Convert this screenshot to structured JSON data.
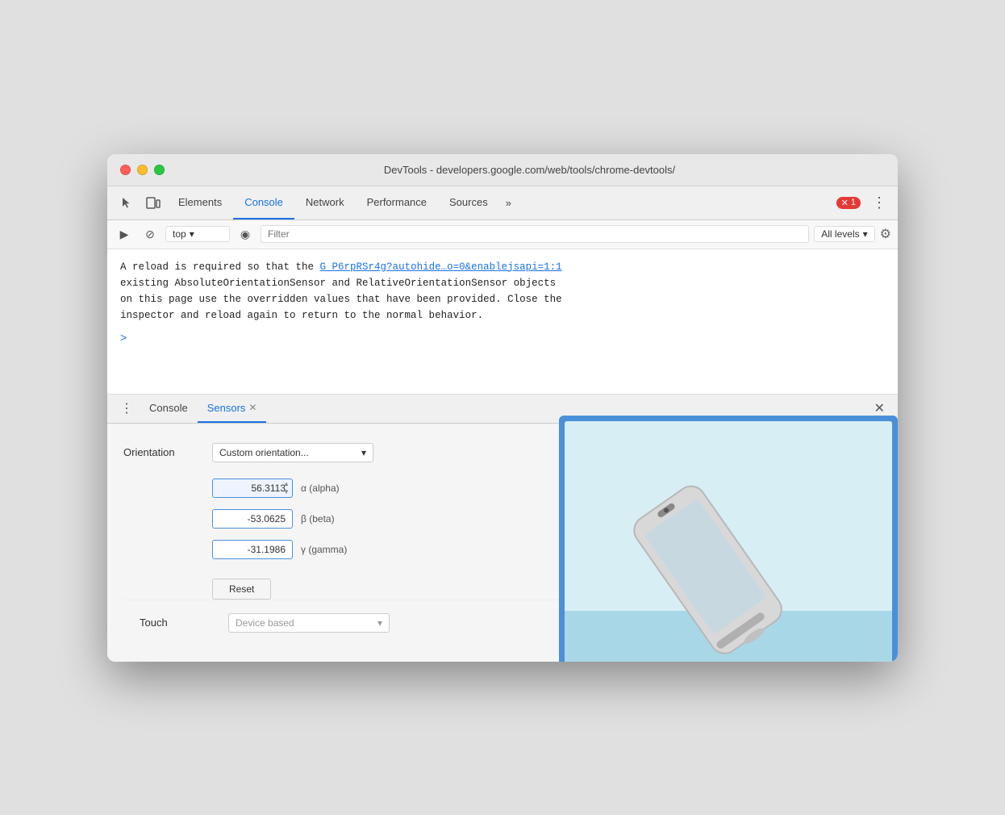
{
  "window": {
    "title": "DevTools - developers.google.com/web/tools/chrome-devtools/"
  },
  "titlebar": {
    "traffic_lights": [
      "red",
      "yellow",
      "green"
    ]
  },
  "devtools_tabs": {
    "items": [
      {
        "label": "Elements",
        "active": false
      },
      {
        "label": "Console",
        "active": true
      },
      {
        "label": "Network",
        "active": false
      },
      {
        "label": "Performance",
        "active": false
      },
      {
        "label": "Sources",
        "active": false
      }
    ],
    "more_label": "»",
    "error_count": "1",
    "menu_icon": "⋮"
  },
  "console_toolbar": {
    "play_icon": "▶",
    "block_icon": "⊘",
    "context_value": "top",
    "dropdown_arrow": "▾",
    "eye_icon": "◉",
    "filter_placeholder": "Filter",
    "levels_label": "All levels",
    "levels_arrow": "▾",
    "gear_icon": "⚙"
  },
  "console_output": {
    "message_line1": "A reload is required so that the ",
    "message_link": "G_P6rpRSr4g?autohide…o=0&enablejsapi=1:1",
    "message_line2": "existing AbsoluteOrientationSensor and RelativeOrientationSensor objects",
    "message_line3": "on this page use the overridden values that have been provided. Close the",
    "message_line4": "inspector and reload again to return to the normal behavior.",
    "prompt_icon": ">"
  },
  "drawer": {
    "tabs": [
      {
        "label": "Console",
        "active": false,
        "closeable": false
      },
      {
        "label": "Sensors",
        "active": true,
        "closeable": true
      }
    ],
    "more_icon": "⋮",
    "close_icon": "✕"
  },
  "sensors": {
    "orientation_label": "Orientation",
    "orientation_value": "Custom orientation...",
    "orientation_dropdown": "▾",
    "alpha_value": "56.3113",
    "alpha_label": "α (alpha)",
    "beta_value": "-53.0625",
    "beta_label": "β (beta)",
    "gamma_value": "-31.1986",
    "gamma_label": "γ (gamma)",
    "reset_label": "Reset",
    "touch_label": "Touch",
    "touch_value": "Device based",
    "touch_dropdown": "▾"
  }
}
